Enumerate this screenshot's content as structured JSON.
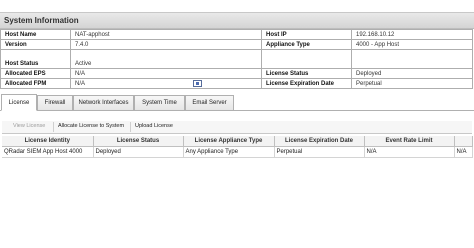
{
  "panel": {
    "title": "System Information"
  },
  "info": {
    "rows": [
      {
        "l1": "Host Name",
        "v1": "NAT-apphost",
        "l2": "Host IP",
        "v2": "192.168.10.12"
      },
      {
        "l1": "Version",
        "v1": "7.4.0",
        "l2": "Appliance Type",
        "v2": "4000 - App Host"
      },
      {
        "l1": "Host Status",
        "v1": "Active",
        "l2": "",
        "v2": ""
      },
      {
        "l1": "Allocated EPS",
        "v1": "N/A",
        "l2": "License Status",
        "v2": "Deployed"
      },
      {
        "l1": "Allocated FPM",
        "v1": "N/A",
        "l2": "License Expiration Date",
        "v2": "Perpetual"
      }
    ]
  },
  "tabs": [
    "License",
    "Firewall",
    "Network Interfaces",
    "System Time",
    "Email Server"
  ],
  "toolbar": {
    "view_license": "View License",
    "allocate_license": "Allocate License to System",
    "upload_license": "Upload License"
  },
  "license_table": {
    "columns": [
      "License Identity",
      "License Status",
      "License Appliance Type",
      "License Expiration Date",
      "Event Rate Limit",
      ""
    ],
    "rows": [
      [
        "QRadar SIEM App Host 4000",
        "Deployed",
        "Any Appliance Type",
        "Perpetual",
        "N/A",
        "N/A"
      ]
    ]
  }
}
